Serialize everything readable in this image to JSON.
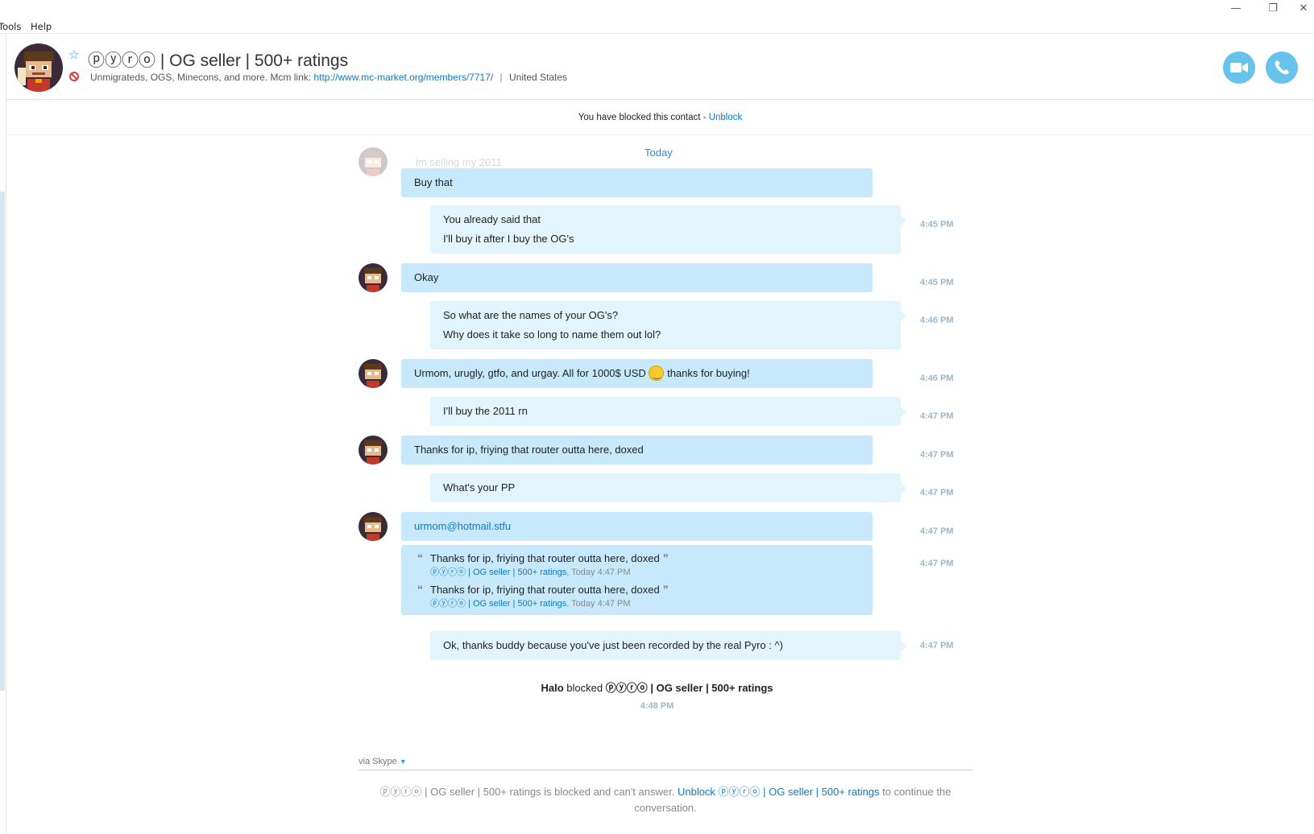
{
  "menu": {
    "tools": "Tools",
    "help": "Help"
  },
  "window": {
    "minimize": "—",
    "restore": "❐",
    "close": "✕"
  },
  "contact": {
    "name": "ⓟⓨⓡⓞ | OG seller | 500+ ratings",
    "mood": "Unmigrateds, OGS, Minecons, and more. Mcm link:",
    "link": "http://www.mc-market.org/members/7717/",
    "sep": "|",
    "location": "United States"
  },
  "blocked_bar": {
    "text": "You have blocked this contact - ",
    "action": "Unblock"
  },
  "chat": {
    "today": "Today",
    "faded_text": "im selling my 2011",
    "messages": [
      {
        "dir": "in",
        "lines": [
          "Buy that"
        ],
        "time": ""
      },
      {
        "dir": "out",
        "lines": [
          "You already said that",
          "I'll buy it after I buy the OG's"
        ],
        "time": "4:45 PM"
      },
      {
        "dir": "in",
        "lines": [
          "Okay"
        ],
        "time": "4:45 PM"
      },
      {
        "dir": "out",
        "lines": [
          "So what are the names of your OG's?",
          "Why does it take so long to name them out lol?"
        ],
        "time": "4:46 PM"
      },
      {
        "dir": "in",
        "text_a": "Urmom, urugly, gtfo, and urgay. All for 1000$ USD",
        "text_b": "thanks for buying!",
        "time": "4:46 PM"
      },
      {
        "dir": "out",
        "lines": [
          "I'll buy the 2011 rn"
        ],
        "time": "4:47 PM"
      },
      {
        "dir": "in",
        "lines": [
          "Thanks for ip, friying that router outta here, doxed"
        ],
        "time": "4:47 PM"
      },
      {
        "dir": "out",
        "lines": [
          "What's your PP"
        ],
        "time": "4:47 PM"
      },
      {
        "dir": "in",
        "link": "urmom@hotmail.stfu",
        "time": "4:47 PM"
      },
      {
        "dir": "in",
        "quote_text": "Thanks for ip, friying that router outta here, doxed",
        "quote_name": "ⓟⓨⓡⓞ | OG seller | 500+ ratings",
        "quote_when": ", Today 4:47 PM",
        "time": "4:47 PM"
      },
      {
        "dir": "out",
        "lines": [
          "Ok, thanks buddy because you've just been recorded by the real Pyro : ^)"
        ],
        "time": "4:47 PM"
      }
    ],
    "system": {
      "actor": "Halo",
      "verb": " blocked ",
      "target": "ⓟⓨⓡⓞ | OG seller | 500+ ratings",
      "time": "4:48 PM"
    }
  },
  "compose": {
    "via": "via Skype",
    "note_a": "ⓟⓨⓡⓞ | OG seller | 500+ ratings is blocked and can't answer. ",
    "note_link": "Unblock ⓟⓨⓡⓞ | OG seller | 500+ ratings",
    "note_b": " to continue the conversation."
  },
  "colors": {
    "accent": "#0a7bc7",
    "bubble_in": "#c7e9fb",
    "bubble_out": "#e2f4fc",
    "call_button": "#68c3ec",
    "blocked": "#e0383e"
  }
}
